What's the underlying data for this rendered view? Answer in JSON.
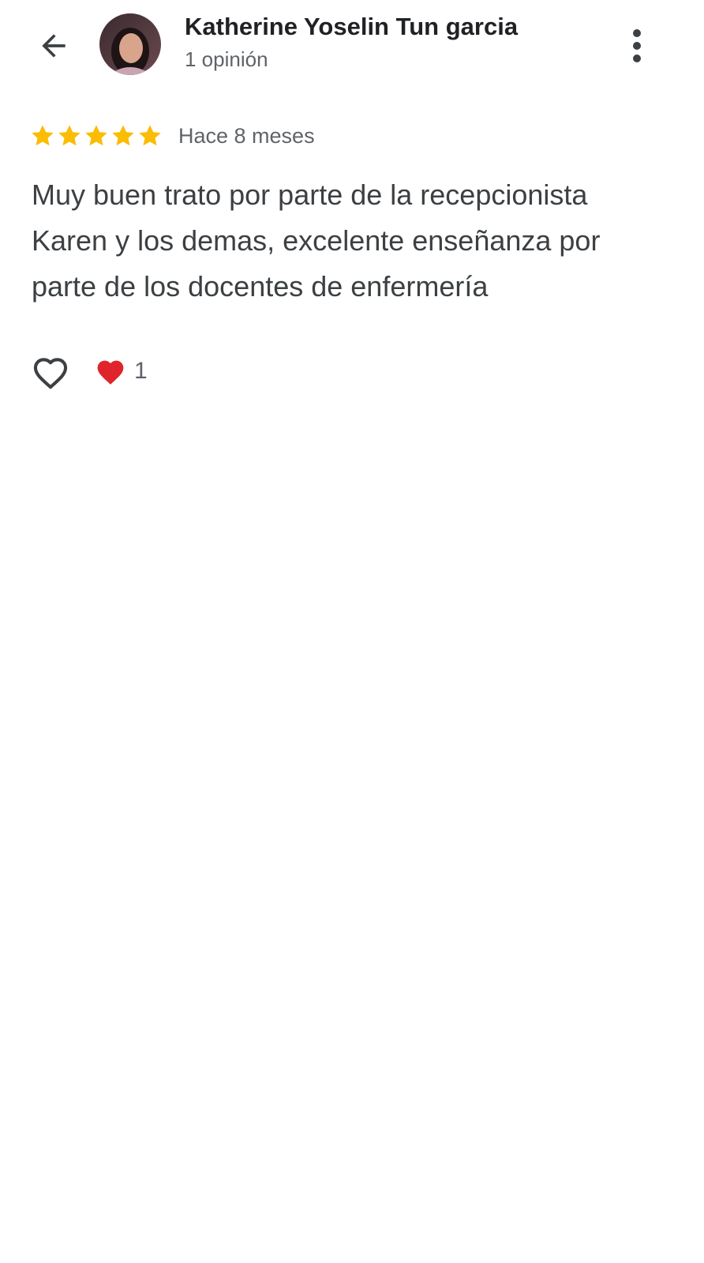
{
  "header": {
    "back_icon": "arrow-back-icon",
    "author_name": "Katherine Yoselin Tun garcia",
    "author_meta": "1 opinión",
    "more_icon": "more-vert-icon"
  },
  "review": {
    "rating": 5,
    "rating_max": 5,
    "star_color": "#fbbc04",
    "date": "Hace 8 meses",
    "text": "Muy buen trato por parte de la recepcionista Karen y los demas, excelente enseñanza por parte de los docentes de enfermería"
  },
  "actions": {
    "like_icon": "heart-outline-icon",
    "reaction_icon": "red-heart-icon",
    "reaction_color": "#e0242c",
    "reaction_count": "1"
  }
}
